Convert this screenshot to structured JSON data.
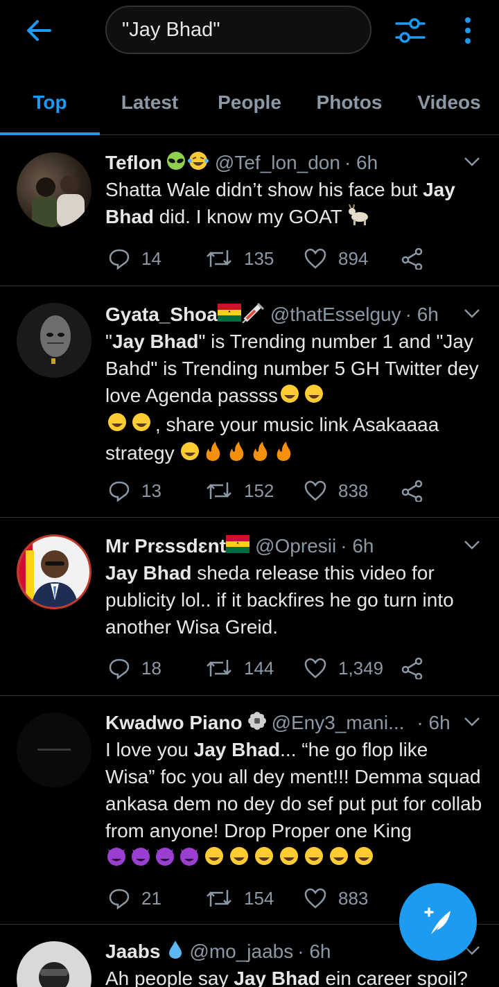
{
  "search": {
    "query": "\"Jay Bhad\""
  },
  "tabs": [
    "Top",
    "Latest",
    "People",
    "Photos",
    "Videos"
  ],
  "colors": {
    "accent": "#1d9bf0",
    "muted": "#8b98a5",
    "text": "#e7e7e7",
    "divider": "#2f3336"
  },
  "tweets": [
    {
      "name": "Teflon",
      "handle": "@Tef_lon_don",
      "time": "· 6h",
      "text_parts": [
        "Shatta Wale didn’t show his face but ",
        "Jay Bhad",
        " did. I know my GOAT"
      ],
      "replies": "14",
      "retweets": "135",
      "likes": "894"
    },
    {
      "name": "Gyata_Shoa",
      "handle": "@thatEsselguy",
      "time": "· 6h",
      "text_parts": [
        "\"",
        "Jay Bhad",
        "\" is Trending number 1 and \"Jay Bahd\" is Trending number 5 GH Twitter dey love Agenda passss",
        ", share your music link Asakaaaa strategy"
      ],
      "replies": "13",
      "retweets": "152",
      "likes": "838"
    },
    {
      "name": "Mr Prɛssdɛnt",
      "handle": "@Opresii",
      "time": "· 6h",
      "text_parts": [
        "Jay Bhad",
        " sheda release this video for publicity lol.. if it backfires he go turn into another Wisa Greid."
      ],
      "replies": "18",
      "retweets": "144",
      "likes": "1,349"
    },
    {
      "name": "Kwadwo Piano",
      "handle": "@Eny3_mani...",
      "time": "· 6h",
      "text_parts": [
        "I love you ",
        "Jay Bhad",
        "... “he go flop like Wisa” foc you all dey ment!!! Demma squad ankasa dem no dey do sef put put for collab from anyone! Drop Proper one King"
      ],
      "replies": "21",
      "retweets": "154",
      "likes": "883"
    },
    {
      "name": "Jaabs",
      "handle": "@mo_jaabs",
      "time": "· 6h",
      "text_parts": [
        "Ah people say ",
        "Jay Bhad",
        " ein career spoil?"
      ]
    }
  ]
}
